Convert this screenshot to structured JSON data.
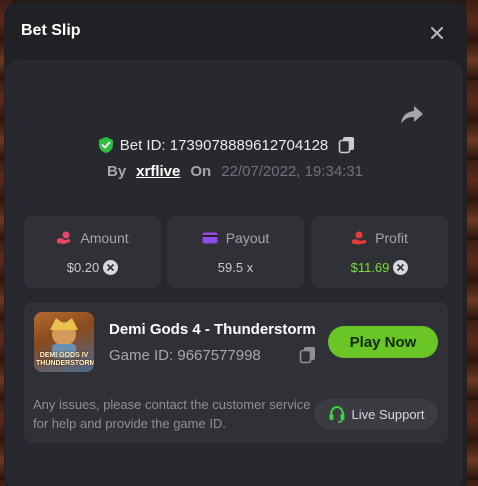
{
  "modal": {
    "title": "Bet Slip",
    "close_icon": "close-icon",
    "share_icon": "share-icon"
  },
  "bet": {
    "id_text": "Bet ID: 1739078889612704128",
    "verified_icon": "shield-check-icon",
    "copy_icon": "copy-icon",
    "by_label": "By",
    "username": "xrflive",
    "on_label": "On",
    "datetime": "22/07/2022, 19:34:31"
  },
  "stats": [
    {
      "label": "Amount",
      "value": "$0.20",
      "icon": "coin-hand-icon",
      "icon_color": "#e8456a",
      "value_color": "#c9cbd0",
      "currency_chip": true
    },
    {
      "label": "Payout",
      "value": "59.5 x",
      "icon": "wallet-icon",
      "icon_color": "#8f4be8",
      "value_color": "#c9cbd0",
      "currency_chip": false
    },
    {
      "label": "Profit",
      "value": "$11.69",
      "icon": "hand-coin-icon",
      "icon_color": "#e83a3a",
      "value_color": "#7bdb3c",
      "currency_chip": true
    }
  ],
  "game": {
    "title": "Demi Gods 4 - Thunderstorm",
    "id_text": "Game ID: 9667577998",
    "thumb_caption": "DEMI GODS IV THUNDERSTORM",
    "play_label": "Play Now",
    "issues_text": "Any issues, please contact the customer service for help and provide the game ID.",
    "support_label": "Live Support",
    "support_icon": "headset-icon"
  },
  "colors": {
    "accent_green": "#6ac526",
    "profit_green": "#7bdb3c",
    "background": "#202125",
    "card": "#28292e",
    "panel": "#303136"
  }
}
